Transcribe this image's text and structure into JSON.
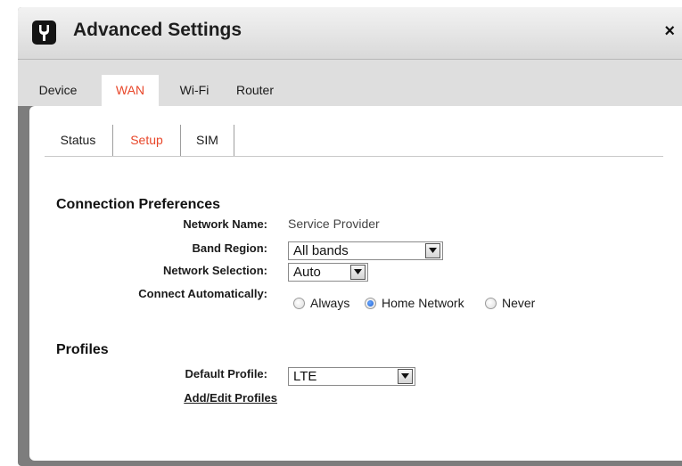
{
  "dialog": {
    "title": "Advanced Settings",
    "close_symbol": "×",
    "title_icon": "wrench-icon"
  },
  "main_tabs": [
    {
      "label": "Device",
      "active": false
    },
    {
      "label": "WAN",
      "active": true
    },
    {
      "label": "Wi-Fi",
      "active": false
    },
    {
      "label": "Router",
      "active": false
    }
  ],
  "sub_tabs": [
    {
      "label": "Status",
      "active": false
    },
    {
      "label": "Setup",
      "active": true
    },
    {
      "label": "SIM",
      "active": false
    }
  ],
  "connection_preferences": {
    "heading": "Connection Preferences",
    "network_name_label": "Network Name:",
    "network_name_value": "Service Provider",
    "band_region_label": "Band Region:",
    "band_region_value": "All bands",
    "network_selection_label": "Network Selection:",
    "network_selection_value": "Auto",
    "connect_automatically_label": "Connect Automatically:",
    "connect_options": [
      {
        "label": "Always",
        "checked": false
      },
      {
        "label": "Home Network",
        "checked": true
      },
      {
        "label": "Never",
        "checked": false
      }
    ]
  },
  "profiles": {
    "heading": "Profiles",
    "default_profile_label": "Default Profile:",
    "default_profile_value": "LTE",
    "add_edit_link": "Add/Edit Profiles"
  },
  "colors": {
    "accent": "#e8472a",
    "frame": "#7d7d7d",
    "tabbar": "#dedede"
  }
}
